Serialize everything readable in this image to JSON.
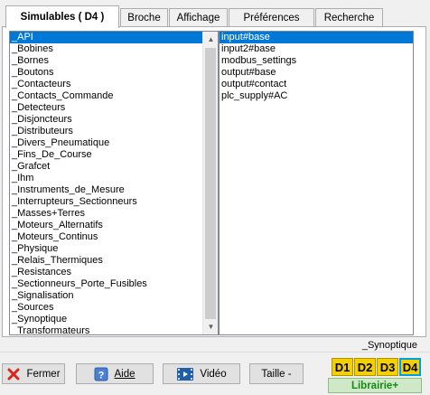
{
  "tabs": [
    {
      "label": "Simulables ( D4 )",
      "active": true
    },
    {
      "label": "Broche",
      "active": false
    },
    {
      "label": "Affichage",
      "active": false
    },
    {
      "label": "Préférences",
      "active": false
    },
    {
      "label": "Recherche",
      "active": false
    }
  ],
  "left_list": {
    "items": [
      "_API",
      "_Bobines",
      "_Bornes",
      "_Boutons",
      "_Contacteurs",
      "_Contacts_Commande",
      "_Detecteurs",
      "_Disjoncteurs",
      "_Distributeurs",
      "_Divers_Pneumatique",
      "_Fins_De_Course",
      "_Grafcet",
      "_Ihm",
      "_Instruments_de_Mesure",
      "_Interrupteurs_Sectionneurs",
      "_Masses+Terres",
      "_Moteurs_Alternatifs",
      "_Moteurs_Continus",
      "_Physique",
      "_Relais_Thermiques",
      "_Resistances",
      "_Sectionneurs_Porte_Fusibles",
      "_Signalisation",
      "_Sources",
      "_Synoptique",
      "_Transformateurs"
    ],
    "selected": "_API"
  },
  "right_list": {
    "items": [
      "input#base",
      "input2#base",
      "modbus_settings",
      "output#base",
      "output#contact",
      "plc_supply#AC"
    ],
    "selected": "input#base"
  },
  "status": "_Synoptique",
  "buttons": {
    "close": "Fermer",
    "help": "Aide",
    "video": "Vidéo",
    "size": "Taille -"
  },
  "display_tabs": [
    "D1",
    "D2",
    "D3",
    "D4"
  ],
  "display_active": "D4",
  "library_button": "Librairie+",
  "colors": {
    "selection": "#0078d7",
    "display_tab": "#f4d000",
    "library_text": "#138a13",
    "close_icon": "#d9261c"
  }
}
